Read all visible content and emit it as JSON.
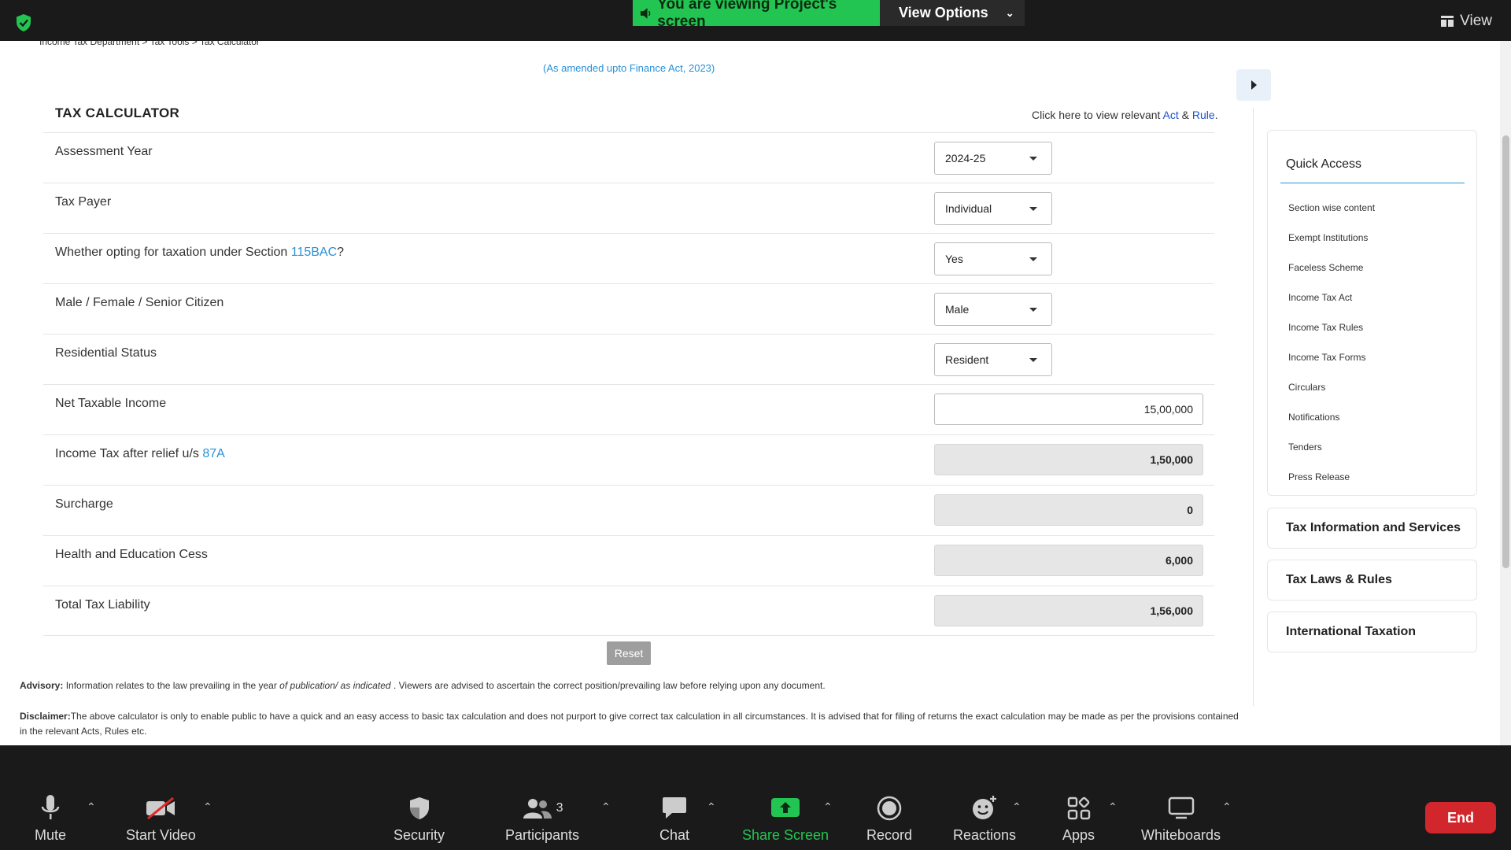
{
  "zoom": {
    "banner_text": "You are viewing Project's screen",
    "view_options": "View Options",
    "top_right_view": "View",
    "toolbar": {
      "mute": "Mute",
      "start_video": "Start Video",
      "security": "Security",
      "participants": "Participants",
      "participants_count": "3",
      "chat": "Chat",
      "share_screen": "Share Screen",
      "record": "Record",
      "reactions": "Reactions",
      "apps": "Apps",
      "whiteboards": "Whiteboards",
      "end": "End"
    },
    "colors": {
      "accent_green": "#23c552",
      "end_red": "#d1262c"
    }
  },
  "page": {
    "breadcrumb": "Income Tax Department  >  Tax Tools  >  Tax Calculator",
    "amended": "(As amended upto Finance Act, 2023)",
    "title": "TAX CALCULATOR",
    "act_note": {
      "prefix": "Click here to view relevant ",
      "act": "Act",
      "amp": " & ",
      "rule": "Rule",
      "suffix": "."
    },
    "rows": {
      "assessment_year": {
        "label": "Assessment Year",
        "value": "2024-25"
      },
      "tax_payer": {
        "label": "Tax Payer",
        "value": "Individual"
      },
      "opting": {
        "label_pre": "Whether opting for taxation under Section ",
        "label_link": "115BAC",
        "label_post": "?",
        "value": "Yes"
      },
      "gender": {
        "label": "Male / Female / Senior Citizen",
        "value": "Male"
      },
      "residential": {
        "label": "Residential Status",
        "value": "Resident"
      },
      "net_income": {
        "label": "Net Taxable Income",
        "value": "15,00,000"
      },
      "income_tax": {
        "label_pre": "Income Tax after relief u/s ",
        "label_link": "87A",
        "value": "1,50,000"
      },
      "surcharge": {
        "label": "Surcharge",
        "value": "0"
      },
      "cess": {
        "label": "Health and Education Cess",
        "value": "6,000"
      },
      "total": {
        "label": "Total Tax Liability",
        "value": "1,56,000"
      }
    },
    "reset": "Reset",
    "advisory": {
      "bold": "Advisory:",
      "text1": " Information relates to the law prevailing in the year ",
      "italic": "of publication/ as indicated",
      "text2": " . Viewers are advised to ascertain the correct position/prevailing law before relying upon any document."
    },
    "disclaimer": {
      "bold": "Disclaimer:",
      "text": "The above calculator is only to enable public to have a quick and an easy access to basic tax calculation and does not purport to give correct tax calculation in all circumstances. It is advised that for filing of returns the exact calculation may be made as per the provisions contained in the relevant Acts, Rules etc."
    },
    "sidebar": {
      "quick_access_title": "Quick Access",
      "quick_access_items": [
        "Section wise content",
        "Exempt Institutions",
        "Faceless Scheme",
        "Income Tax Act",
        "Income Tax Rules",
        "Income Tax Forms",
        "Circulars",
        "Notifications",
        "Tenders",
        "Press Release"
      ],
      "cards": [
        "Tax Information and Services",
        "Tax Laws & Rules",
        "International Taxation"
      ]
    }
  }
}
